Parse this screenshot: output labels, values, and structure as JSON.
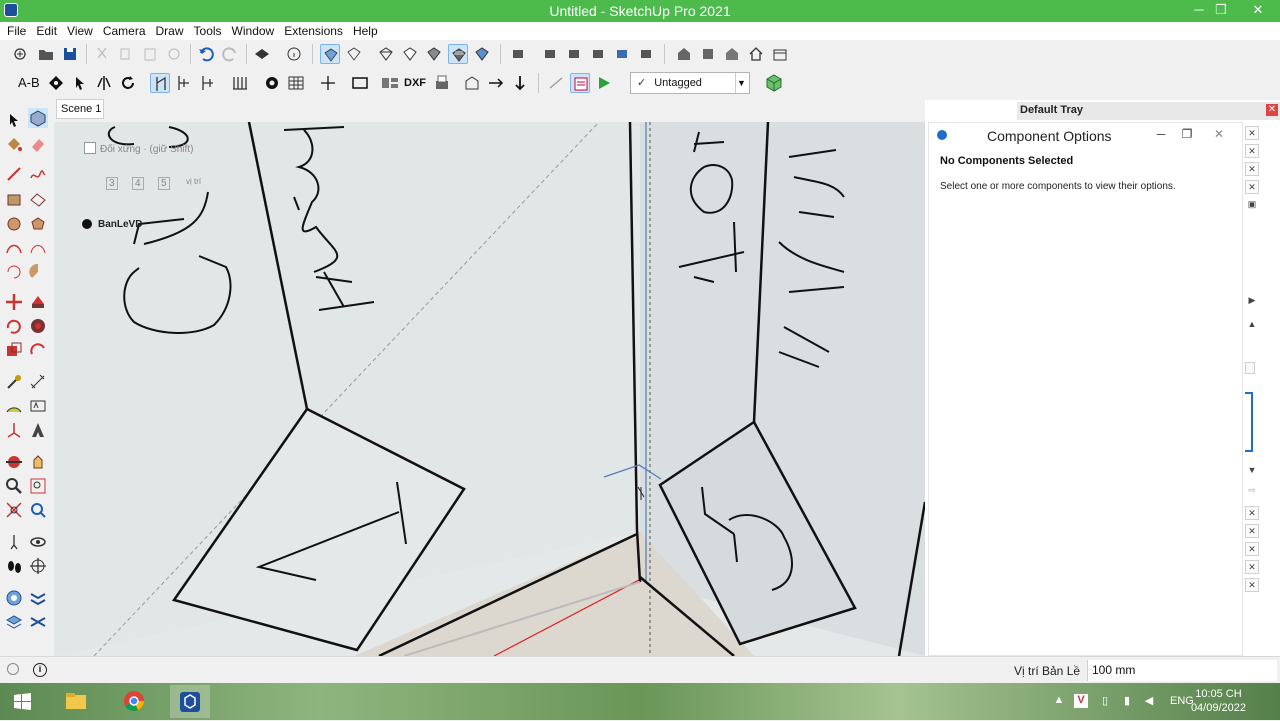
{
  "window": {
    "title": "Untitled - SketchUp Pro 2021",
    "minimize": "─",
    "maximize": "❐",
    "close": "✕"
  },
  "menu": [
    "File",
    "Edit",
    "View",
    "Camera",
    "Draw",
    "Tools",
    "Window",
    "Extensions",
    "Help"
  ],
  "toolbar2": {
    "text_tool_label": "A-B",
    "dxf_label": "DXF",
    "tag_checkmark": "✓",
    "tag_value": "Untagged"
  },
  "scene_tab": "Scene 1",
  "viewport_overlay": {
    "checkbox_label": "Đối xứng  ·  (giữ Shift)",
    "numbers": [
      "3",
      "4",
      "5"
    ],
    "tiny_text": "vị trí",
    "plugin_label": "BanLeVD"
  },
  "drawing_text": {
    "left_panel_word": "Huỳnh",
    "right_panel_word_top": "Hồ",
    "right_panel_word": "Huỳnh",
    "left_diamond": "1",
    "right_diamond": "5",
    "far_left_word": "Cu"
  },
  "tray": {
    "title": "Default Tray",
    "close": "✕",
    "panel_title": "Component Options",
    "panel_minimize": "─",
    "panel_restore": "❐",
    "panel_close": "✕",
    "no_selection": "No Components Selected",
    "hint": "Select one or more components to view their options."
  },
  "status": {
    "info": "i",
    "measurement_label": "Vị trí Bản Lề",
    "measurement_value": "100 mm"
  },
  "taskbar": {
    "language": "ENG",
    "time": "10:05 CH",
    "date": "04/09/2022"
  },
  "colors": {
    "titlebar": "#4cbb4c",
    "viewport": "#e4e8e8",
    "accent": "#1e6fc6",
    "red_axis": "#d22",
    "green_axis": "#2a2"
  }
}
